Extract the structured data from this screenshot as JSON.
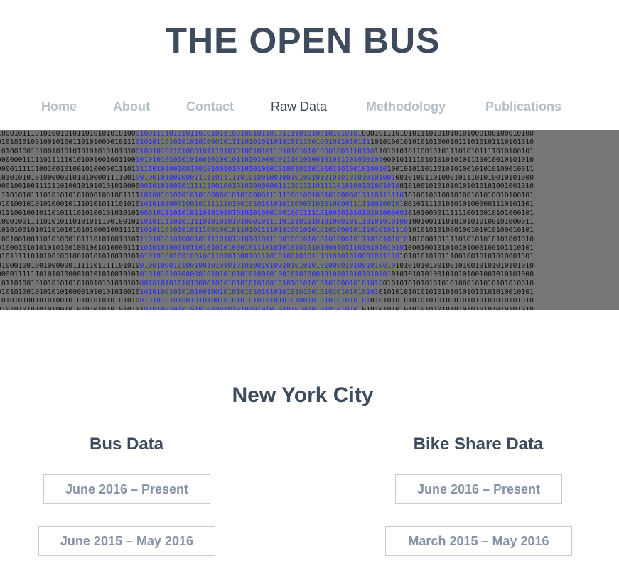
{
  "site": {
    "title": "THE OPEN BUS"
  },
  "nav": {
    "items": [
      {
        "label": "Home"
      },
      {
        "label": "About"
      },
      {
        "label": "Contact"
      },
      {
        "label": "Raw Data",
        "active": true
      },
      {
        "label": "Methodology"
      },
      {
        "label": "Publications"
      }
    ]
  },
  "banner": {
    "background": "#767676",
    "digit_color": "#101010",
    "highlight_color": "#2a2af0",
    "rows": [
      "10001011101010010101101010101010001001111010101101010111001001011010111101010010101010100010111010101110101010101000100100010100",
      "01010101001001010011010100001011101010110101010101000101111010101101010111001001011010111101010010101010100010111010101110101010",
      "10100100101001010101010101010101001001010110100010111010101001010110101010101000100111011011010101011001010111010101111010100101",
      "00000011111011111010100100100110010101010101010100101001011010100010111010100101011101010101000101111010101010101110010010101010",
      "00001111110010010100101000001110111110101001001001010010101010101010100101001010110100101001010010101101101010100101010100010011",
      "10101010101000000101010000111100100100101000000111110111110101001001001010010101010101010101001001010011010001011101010010101000",
      "00010010011111101001010101010100000010101000011111100100101010000001111011110111101010010100101001010010101010101010101001001010",
      "11101010111010101010100010010011111010010101010101000001010100001111110010010010100000111101111101010010010010100101010010100101",
      "01010010101010001011101010111010101010101000100101111110100101010101010000010101000011111001001010010111101010101000001110101101",
      "01110010010110101110101001010101010001011101010110101010101010100010010011111010010101010101000001010100001111110010010101000101",
      "10001001111010101101010111001001011010111101011110101010101000101111010101010101000101110101010100100100111010101010100101000011",
      "10101001010110101010101000100111101010110101010111001001011010111101010010101010100010111010101110101010101000100101010100010101",
      "10010010011010100010111010100101011101010101000101111010101010101110010010101010100010111010101010101000101111010101010101001010",
      "01000101010101010010010010100001111010101000101101010101000101110101010101010100010111010101010101000100101010101000100101110101",
      "01011111010100100100101010100101010101010010010010011010100010111010100101011101010101000101111010101010101110010010101010001001",
      "01000100100100000011111011111010100100100010100100101010101010010100101010101010000101001010010101010101001001010010101010101010",
      "00001111110101010000101010100101010101010101000001010101010101001010010101000101010101010101010101010101001010101001001010101000",
      "10110100101010101010100101010101010010101010101000010101010101010010101010101010100010101010010101010101010101000101010101010010",
      "01010100101010101000010101010100101010100101010100100101010101010101010101001010101010101010101010101010101010101010101010010101",
      "10101010010101001010101010101010100101010101001010100101010101010101010100101010101010101010101010101010101000101010101010101010",
      "01010101010101001010101010101010101010100101010101010010101010101010101010101010101010101010101010101010101010101010101010101010"
    ]
  },
  "section": {
    "title": "New York City"
  },
  "bus": {
    "title": "Bus Data",
    "buttons": [
      "June 2016 – Present",
      "June 2015 – May 2016"
    ]
  },
  "bike": {
    "title": "Bike Share Data",
    "buttons": [
      "June 2016 – Present",
      "March 2015 – May 2016"
    ]
  }
}
